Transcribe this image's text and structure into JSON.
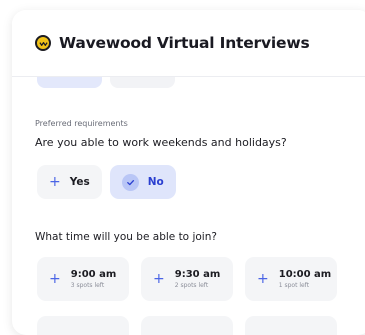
{
  "app": {
    "title": "Wavewood Virtual Interviews",
    "logo_icon": "wave-logo-icon",
    "brand_color": "#f2c318",
    "accent_color": "#4a64e6"
  },
  "form": {
    "section_label": "Preferred requirements",
    "question": "Are you able to work weekends and holidays?",
    "options": [
      {
        "label": "Yes",
        "selected": false,
        "icon": "plus-icon"
      },
      {
        "label": "No",
        "selected": true,
        "icon": "check-icon"
      }
    ],
    "time_question": "What time will you be able to join?",
    "time_slots": [
      {
        "time": "9:00 am",
        "spots": "3 spots left"
      },
      {
        "time": "9:30 am",
        "spots": "2 spots left"
      },
      {
        "time": "10:00 am",
        "spots": "1 spot left"
      }
    ]
  }
}
